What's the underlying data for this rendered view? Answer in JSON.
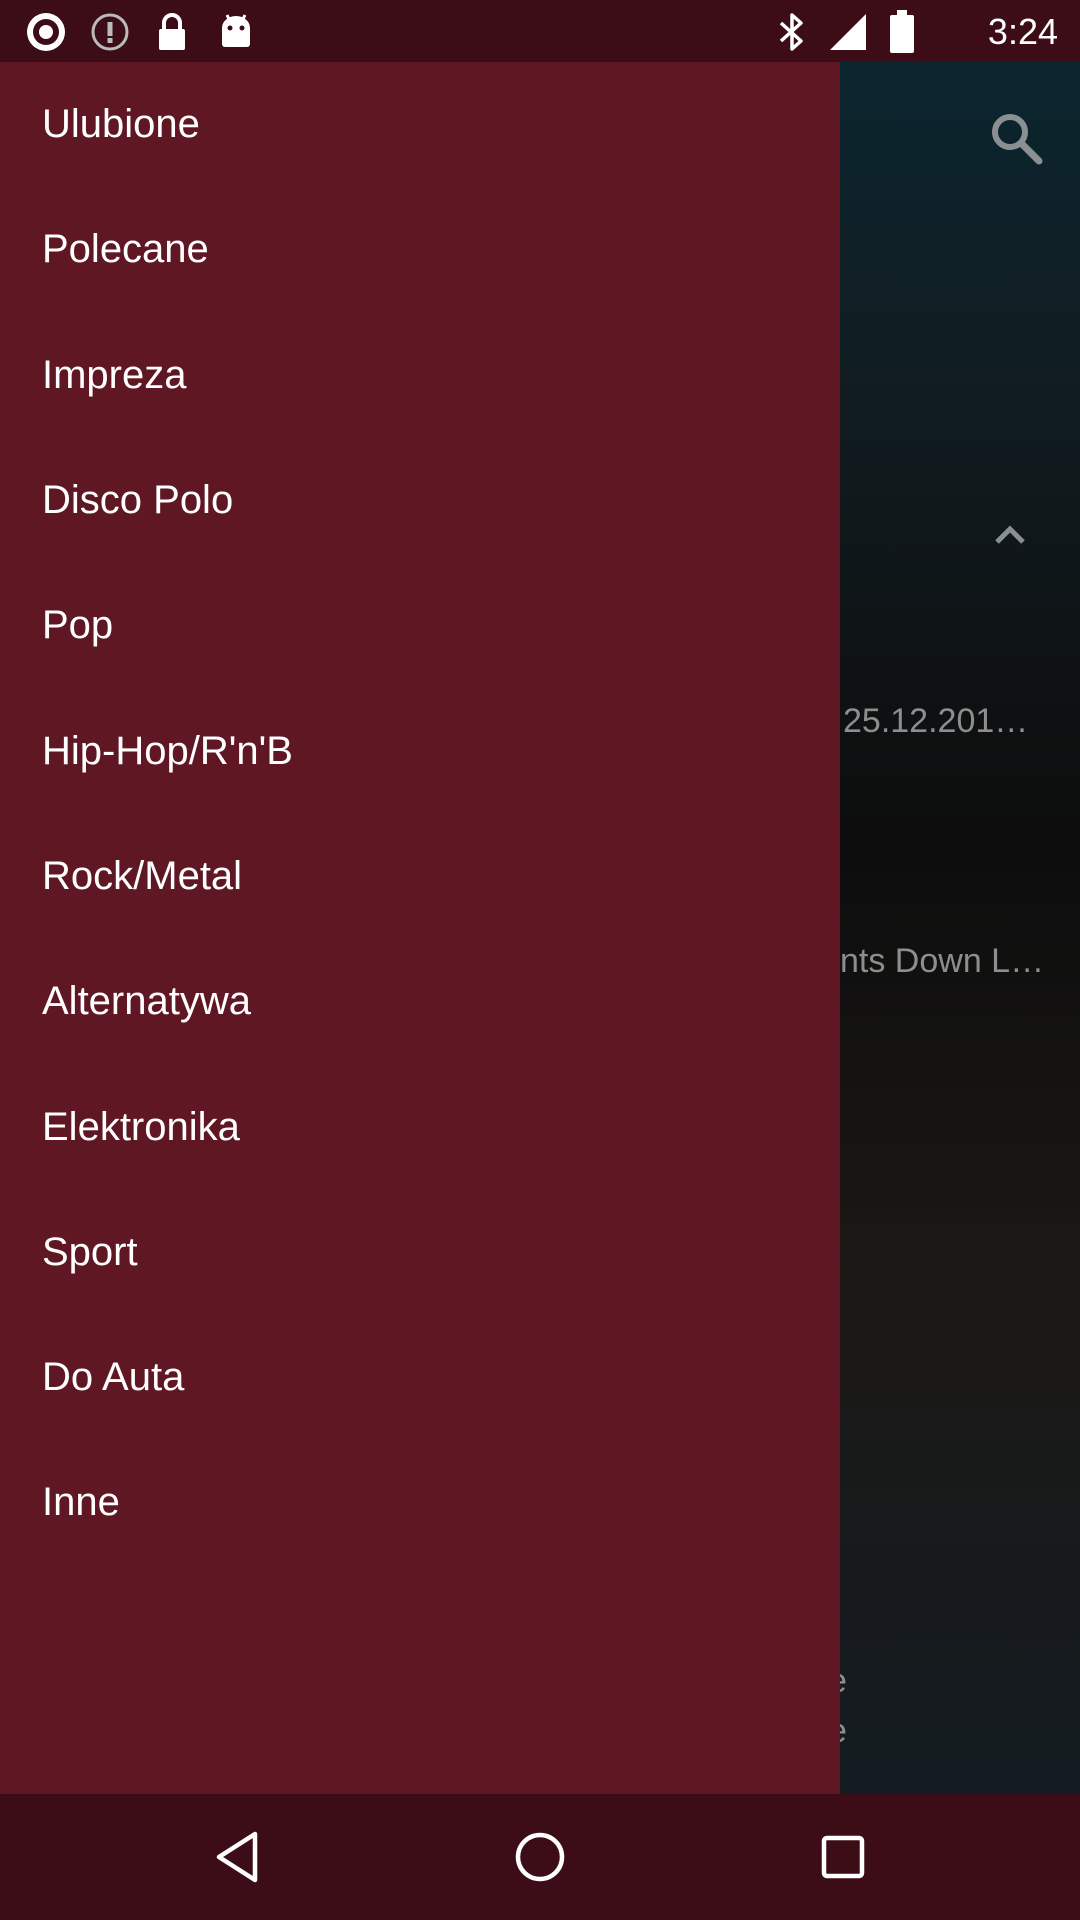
{
  "status_bar": {
    "time": "3:24",
    "left_icons": [
      "radio-icon",
      "info-icon",
      "lock-icon",
      "android-icon"
    ],
    "right_icons": [
      "bluetooth-icon",
      "signal-icon",
      "battery-icon"
    ]
  },
  "background_app": {
    "search_icon": "search-icon",
    "collapse_icon": "chevron-up-icon",
    "date_fragment": "25.12.201…",
    "title_fragment": "nts Down L…",
    "fragment_line_1": "e",
    "fragment_line_2": "e"
  },
  "drawer": {
    "items": [
      {
        "label": "Ulubione"
      },
      {
        "label": "Polecane"
      },
      {
        "label": "Impreza"
      },
      {
        "label": "Disco Polo"
      },
      {
        "label": "Pop"
      },
      {
        "label": "Hip-Hop/R'n'B"
      },
      {
        "label": "Rock/Metal"
      },
      {
        "label": "Alternatywa"
      },
      {
        "label": "Elektronika"
      },
      {
        "label": "Sport"
      },
      {
        "label": "Do Auta"
      },
      {
        "label": "Inne"
      }
    ]
  },
  "nav_bar": {
    "icons": [
      "back-icon",
      "home-icon",
      "recents-icon"
    ]
  },
  "colors": {
    "drawer_background": "#5f1724",
    "system_bar": "#3c0d16",
    "text": "#ffffff"
  }
}
